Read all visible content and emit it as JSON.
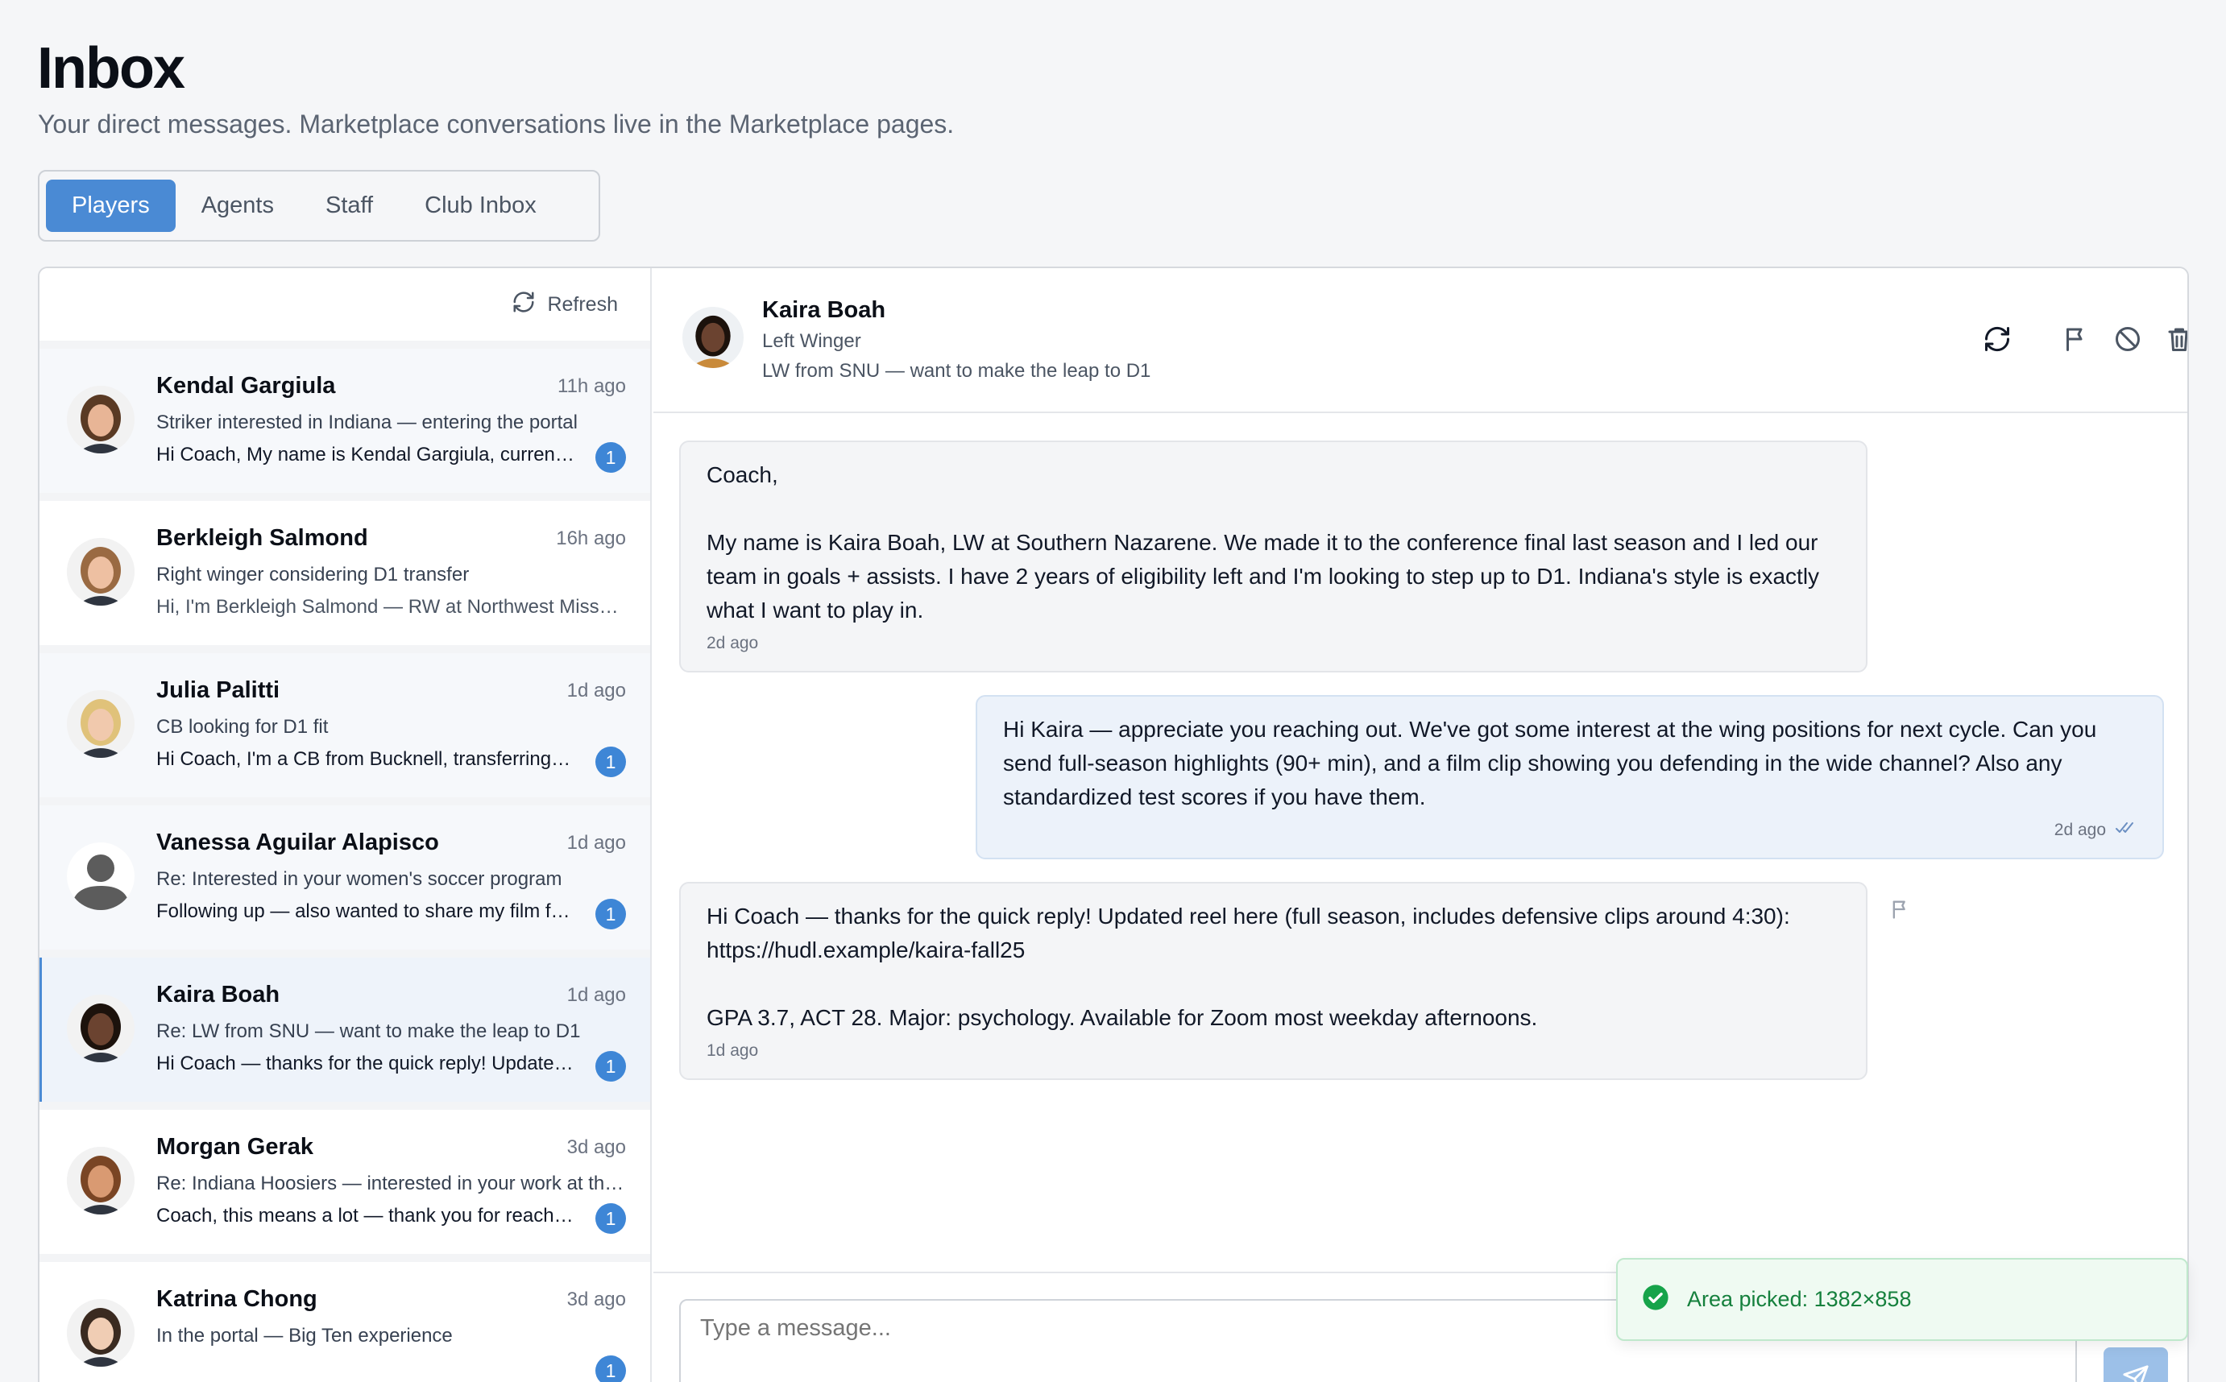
{
  "page": {
    "title": "Inbox",
    "subtitle": "Your direct messages. Marketplace conversations live in the Marketplace pages."
  },
  "tabs": [
    {
      "label": "Players",
      "active": true
    },
    {
      "label": "Agents",
      "active": false
    },
    {
      "label": "Staff",
      "active": false
    },
    {
      "label": "Club Inbox",
      "active": false
    }
  ],
  "list": {
    "refresh_label": "Refresh",
    "conversations": [
      {
        "name": "Kendal Gargiula",
        "time": "11h ago",
        "subject": "Striker interested in Indiana — entering the portal",
        "preview": "Hi Coach, My name is Kendal Gargiula, currently a striker at...",
        "unread": "1",
        "skin": "#e8b596",
        "hair": "#5a3a24"
      },
      {
        "name": "Berkleigh Salmond",
        "time": "16h ago",
        "subject": "Right winger considering D1 transfer",
        "preview": "Hi, I'm Berkleigh Salmond — RW at Northwest Missouri State...",
        "unread": "",
        "skin": "#eec0a2",
        "hair": "#9a6a42"
      },
      {
        "name": "Julia Palitti",
        "time": "1d ago",
        "subject": "CB looking for D1 fit",
        "preview": "Hi Coach, I'm a CB from Bucknell, transferring after this season...",
        "unread": "1",
        "skin": "#f1c9ad",
        "hair": "#e0c27a"
      },
      {
        "name": "Vanessa Aguilar Alapisco",
        "time": "1d ago",
        "subject": "Re: Interested in your women's soccer program",
        "preview": "Following up — also wanted to share my film from last season...",
        "unread": "1",
        "skin": "",
        "hair": ""
      },
      {
        "name": "Kaira Boah",
        "time": "1d ago",
        "subject": "Re: LW from SNU — want to make the leap to D1",
        "preview": "Hi Coach — thanks for the quick reply! Updated reel here...",
        "unread": "1",
        "skin": "#6b4330",
        "hair": "#1c120c"
      },
      {
        "name": "Morgan Gerak",
        "time": "3d ago",
        "subject": "Re: Indiana Hoosiers — interested in your work at the wing",
        "preview": "Coach, this means a lot — thank you for reaching out...",
        "unread": "1",
        "skin": "#d99a72",
        "hair": "#7a4524"
      },
      {
        "name": "Katrina Chong",
        "time": "3d ago",
        "subject": "In the portal — Big Ten experience",
        "preview": "",
        "unread": "1",
        "skin": "#f0cdb4",
        "hair": "#3a2a20"
      }
    ]
  },
  "chat": {
    "name": "Kaira Boah",
    "role": "Left Winger",
    "subject": "LW from SNU — want to make the leap to D1",
    "messages": [
      {
        "direction": "in",
        "lines": [
          "Coach,",
          "",
          "My name is Kaira Boah, LW at Southern Nazarene. We made it to the conference final last season and I led our team in goals + assists. I have 2 years of eligibility left and I'm looking to step up to D1. Indiana's style is exactly what I want to play in."
        ],
        "time": "2d ago"
      },
      {
        "direction": "out",
        "lines": [
          "Hi Kaira — appreciate you reaching out. We've got some interest at the wing positions for next cycle. Can you send full-season highlights (90+ min), and a film clip showing you defending in the wide channel? Also any standardized test scores if you have them."
        ],
        "time": "2d ago"
      },
      {
        "direction": "in",
        "lines": [
          "Hi Coach — thanks for the quick reply! Updated reel here (full season, includes defensive clips around 4:30): https://hudl.example/kaira-fall25",
          "",
          "GPA 3.7, ACT 28. Major: psychology. Available for Zoom most weekday afternoons."
        ],
        "time": "1d ago"
      }
    ],
    "composer_placeholder": "Type a message..."
  },
  "toast": {
    "text": "Area picked: 1382×858"
  },
  "colors": {
    "accent": "#4a8ad4",
    "badge": "#3e86d6",
    "success": "#15803d"
  }
}
